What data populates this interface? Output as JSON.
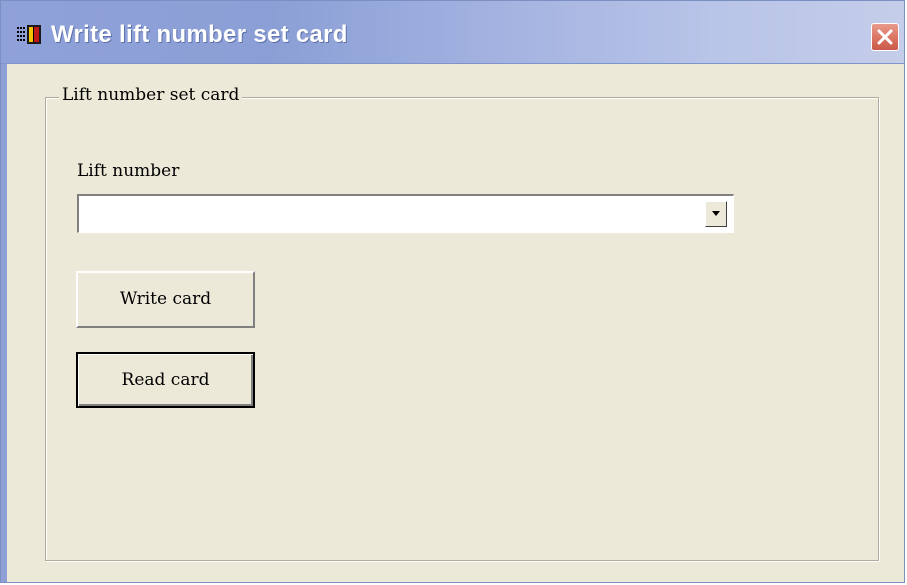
{
  "window": {
    "title": "Write lift number set card",
    "icon": "app-icon",
    "close_icon": "close-icon"
  },
  "groupbox": {
    "legend": "Lift number set card"
  },
  "lift_number": {
    "label": "Lift number",
    "value": "",
    "dropdown_icon": "chevron-down-icon"
  },
  "buttons": {
    "write_card": "Write card",
    "read_card": "Read card"
  },
  "colors": {
    "titlebar": "#8fa1d8",
    "window_bg": "#ece9d8",
    "close_button": "#d9705f"
  }
}
